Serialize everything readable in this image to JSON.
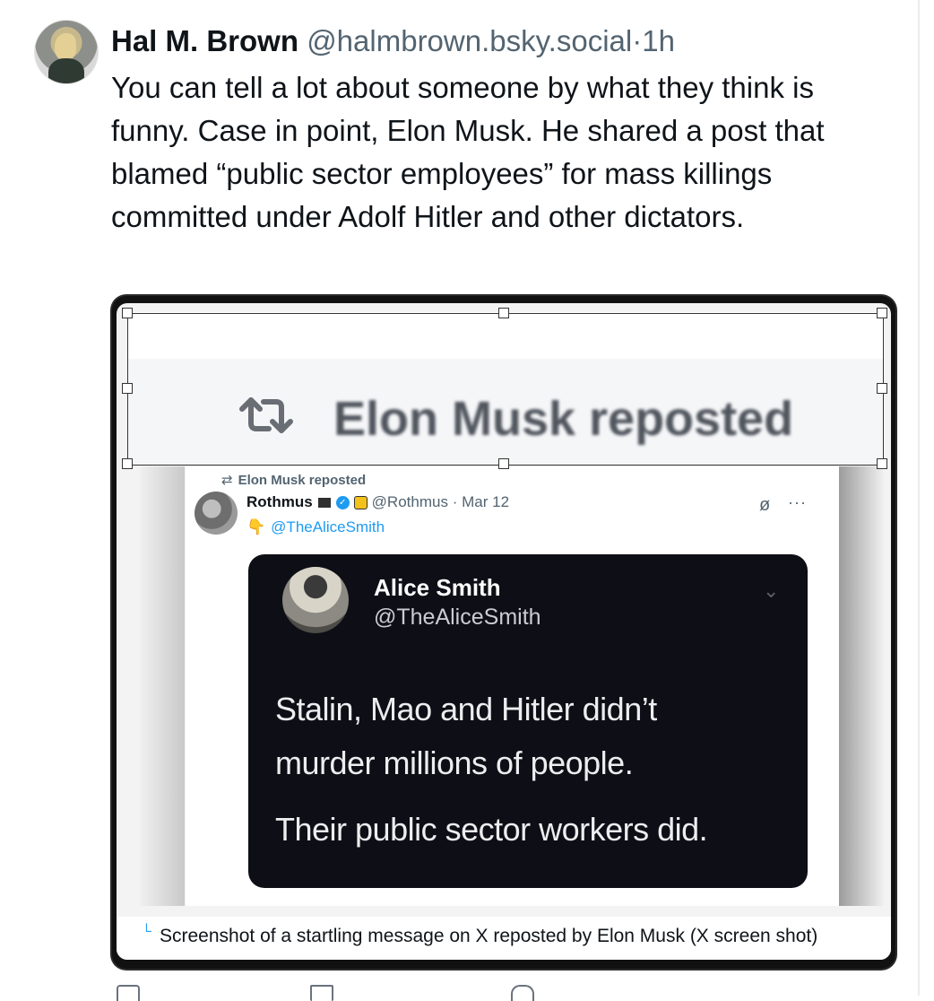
{
  "post": {
    "author_name": "Hal M. Brown",
    "author_handle": "@halmbrown.bsky.social",
    "separator": "·",
    "time": "1h",
    "text": "You can tell a lot about someone by what they think is funny. Case in point, Elon Musk. He shared a post that blamed “public sector employees” for mass killings committed under Adolf Hitler and other dictators."
  },
  "image": {
    "banner_text": "Elon Musk reposted",
    "tweet": {
      "repost_label": "Elon Musk reposted",
      "author_name": "Rothmus",
      "author_handle": "@Rothmus",
      "separator": "·",
      "date": "Mar 12",
      "mention": "@TheAliceSmith",
      "quoted": {
        "name": "Alice Smith",
        "handle": "@TheAliceSmith",
        "lines": [
          "Stalin, Mao and Hitler didn’t",
          "murder millions of people.",
          "Their public sector workers did."
        ]
      }
    },
    "caption": "Screenshot of a startling message on X reposted by Elon Musk (X screen shot)"
  },
  "icons": {
    "repost": "repost-icon",
    "grok": "grok-icon",
    "more": "more-icon",
    "chevron": "chevron-down-icon",
    "caption_corner": "caption-corner-icon"
  },
  "colors": {
    "link": "#1d9bf0",
    "muted": "#536471",
    "dark_card": "#0e0e16"
  }
}
